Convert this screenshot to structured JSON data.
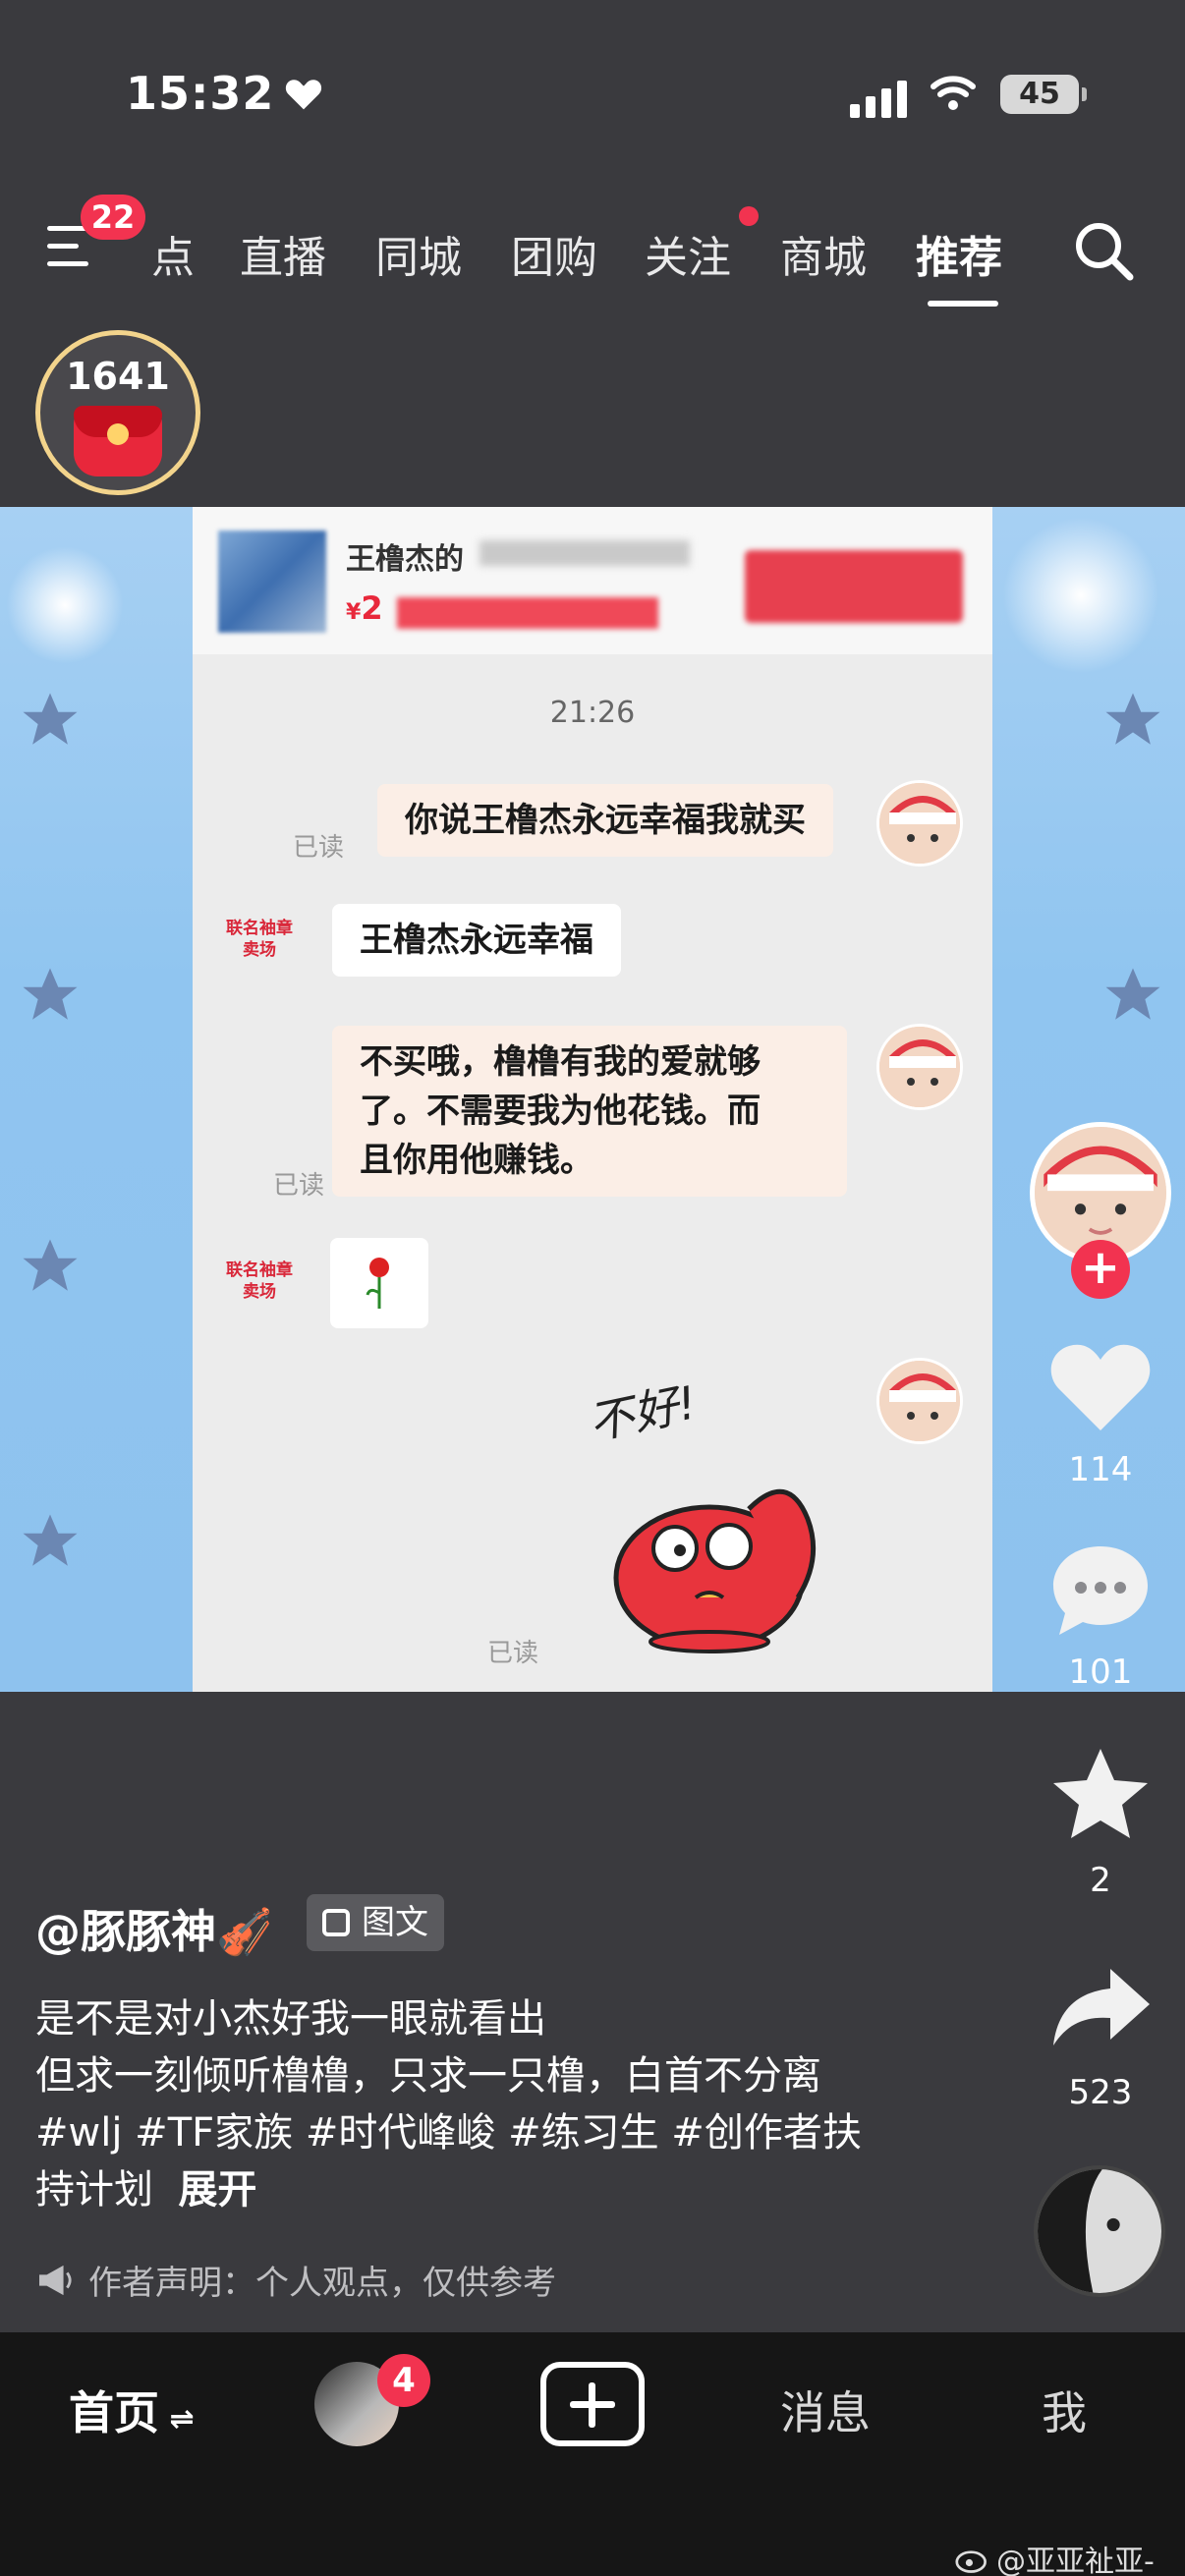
{
  "status_bar": {
    "time": "15:32",
    "battery": "45"
  },
  "top_nav": {
    "menu_badge": "22",
    "tabs": [
      "点",
      "直播",
      "同城",
      "团购",
      "关注",
      "商城",
      "推荐"
    ],
    "active_tab": "推荐"
  },
  "coin": {
    "count": "1641"
  },
  "media": {
    "shop_title": "王橹杰的",
    "price_symbol": "¥",
    "price": "2",
    "chat_time": "21:26",
    "messages": [
      {
        "text": "你说王橹杰永远幸福我就买",
        "read": "已读"
      },
      {
        "text": "王橹杰永远幸福",
        "sender": "联名袖章卖场"
      },
      {
        "text_lines": [
          "不买哦，橹橹有我的爱就够",
          "了。不需要我为他花钱。而",
          "且你用他赚钱。"
        ],
        "read": "已读"
      },
      {
        "sender": "联名袖章卖场"
      },
      {
        "sticker_text": "不好!",
        "read": "已读"
      }
    ]
  },
  "right_rail": {
    "likes": "114",
    "comments": "101",
    "favorites": "2",
    "shares": "523"
  },
  "post": {
    "username": "@豚豚神🎻",
    "type_tag": "图文",
    "line1": "是不是对小杰好我一眼就看出",
    "line2": "但求一刻倾听橹橹，只求一只橹，白首不分离",
    "line3": "#wlj #TF家族 #时代峰峻 #练习生 #创作者扶",
    "line4_prefix": "持计划",
    "expand": "展开",
    "disclaimer": "作者声明：个人观点，仅供参考"
  },
  "bottom_bar": {
    "home": "首页",
    "friend_badge": "4",
    "messages": "消息",
    "me": "我"
  },
  "watermark": "@亚亚祉亚-"
}
